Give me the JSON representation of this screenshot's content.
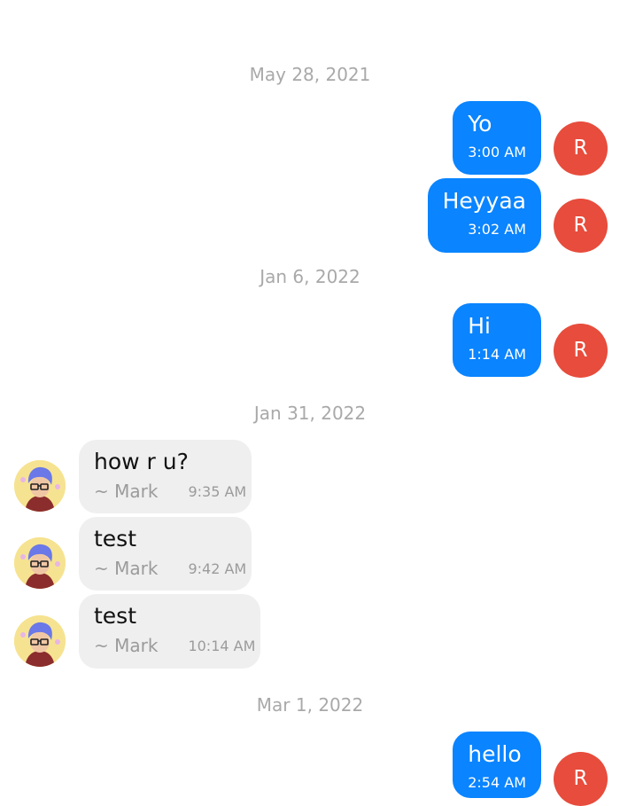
{
  "chat": {
    "groups": [
      {
        "date": "May 28, 2021",
        "messages": [
          {
            "direction": "out",
            "text": "Yo",
            "time": "3:00 AM",
            "avatar_letter": "R"
          },
          {
            "direction": "out",
            "text": "Heyyaa",
            "time": "3:02 AM",
            "avatar_letter": "R"
          }
        ]
      },
      {
        "date": "Jan 6, 2022",
        "messages": [
          {
            "direction": "out",
            "text": "Hi",
            "time": "1:14 AM",
            "avatar_letter": "R"
          }
        ]
      },
      {
        "date": "Jan 31, 2022",
        "messages": [
          {
            "direction": "in",
            "text": "how r u?",
            "sender": "~ Mark",
            "time": "9:35 AM"
          },
          {
            "direction": "in",
            "text": "test",
            "sender": "~ Mark",
            "time": "9:42 AM"
          },
          {
            "direction": "in",
            "text": "test",
            "sender": "~ Mark",
            "time": "10:14 AM"
          }
        ]
      },
      {
        "date": "Mar 1, 2022",
        "messages": [
          {
            "direction": "out",
            "text": "hello",
            "time": "2:54 AM",
            "avatar_letter": "R"
          }
        ]
      }
    ]
  },
  "colors": {
    "outgoing_bubble": "#0a84ff",
    "incoming_bubble": "#efefef",
    "avatar_r": "#e74c3c",
    "date_text": "#a9a9a9"
  }
}
